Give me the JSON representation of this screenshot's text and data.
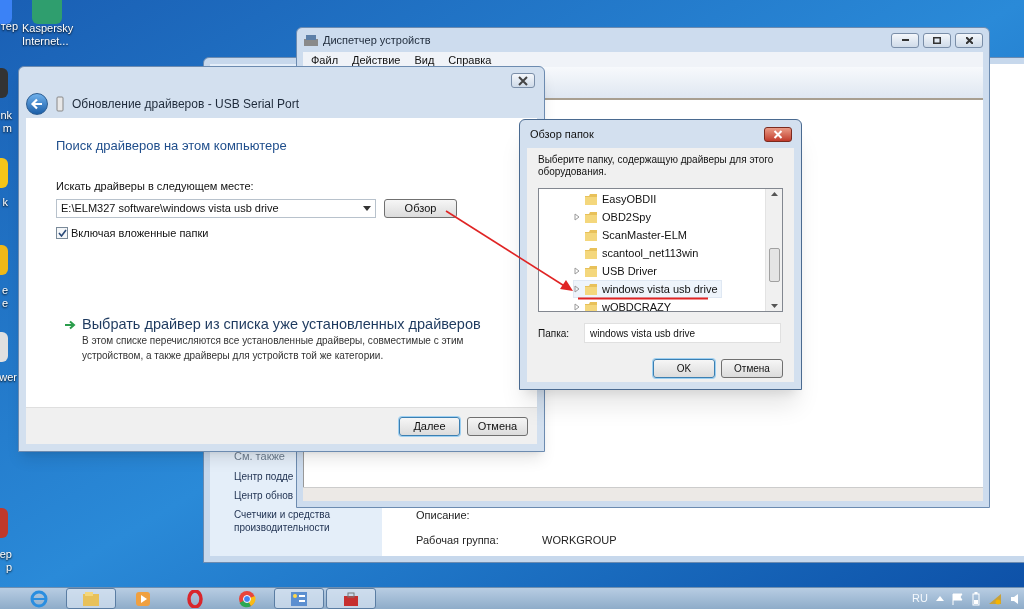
{
  "desktop_icons": [
    {
      "label": [
        "тер"
      ]
    },
    {
      "label": [
        "Kaspersky",
        "Internet..."
      ]
    },
    {
      "label": [
        "nk",
        "m"
      ]
    },
    {
      "label": [
        "k"
      ]
    },
    {
      "label": [
        "e",
        "e"
      ]
    },
    {
      "label": [
        "wer"
      ]
    },
    {
      "label": [
        "ер",
        "р"
      ]
    }
  ],
  "system_window": {
    "see_also_heading": "См. также",
    "see_also_links": [
      "Центр подде",
      "Центр обнов",
      "Счетчики и средства производительности"
    ],
    "fields": [
      {
        "label": "Описание:"
      },
      {
        "label": "Рабочая группа:",
        "value": "WORKGROUP"
      }
    ]
  },
  "device_manager": {
    "title": "Диспетчер устройств",
    "menu": [
      "Файл",
      "Действие",
      "Вид",
      "Справка"
    ]
  },
  "driver_wizard": {
    "title": "Обновление драйверов - USB Serial Port",
    "heading": "Поиск драйверов на этом компьютере",
    "search_label": "Искать драйверы в следующем месте:",
    "path": "E:\\ELM327 software\\windows vista usb drive",
    "browse_button": "Обзор",
    "include_subfolders": {
      "label": "Включая вложенные папки",
      "checked": true
    },
    "pick_link": "Выбрать драйвер из списка уже установленных драйверов",
    "pick_description": "В этом списке перечисляются все установленные драйверы, совместимые с этим устройством, а также драйверы для устройств той же категории.",
    "buttons": [
      {
        "label": "Далее",
        "default": true
      },
      {
        "label": "Отмена",
        "default": false
      }
    ]
  },
  "browse_dialog": {
    "title": "Обзор папок",
    "prompt": "Выберите папку, содержащую драйверы для этого оборудования.",
    "folders": [
      {
        "name": "EasyOBDII",
        "expandable": false,
        "selected": false
      },
      {
        "name": "OBD2Spy",
        "expandable": true,
        "selected": false
      },
      {
        "name": "ScanMaster-ELM",
        "expandable": false,
        "selected": false
      },
      {
        "name": "scantool_net113win",
        "expandable": false,
        "selected": false
      },
      {
        "name": "USB Driver",
        "expandable": true,
        "selected": false
      },
      {
        "name": "windows vista usb drive",
        "expandable": true,
        "selected": true
      },
      {
        "name": "wOBDCRAZY",
        "expandable": true,
        "selected": false
      }
    ],
    "folder_label": "Папка:",
    "folder_value": "windows vista usb drive",
    "buttons": [
      {
        "label": "OK",
        "default": true
      },
      {
        "label": "Отмена",
        "default": false
      }
    ]
  },
  "taskbar": {
    "apps": [
      {
        "kind": "ie",
        "open": false
      },
      {
        "kind": "explorer",
        "open": true
      },
      {
        "kind": "media",
        "open": false
      },
      {
        "kind": "opera",
        "open": false
      },
      {
        "kind": "chrome",
        "open": false
      },
      {
        "kind": "control",
        "open": true
      },
      {
        "kind": "toolbox",
        "open": true
      }
    ],
    "language": "RU"
  }
}
